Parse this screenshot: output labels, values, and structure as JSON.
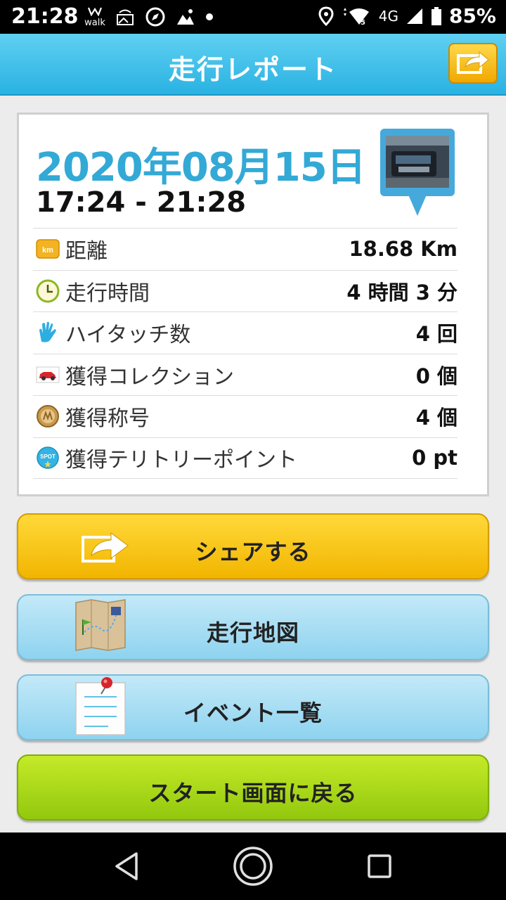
{
  "status_bar": {
    "time": "21:28",
    "walk_label": "walk",
    "network": "4G",
    "battery": "85%",
    "icons": [
      "walk-app-icon",
      "photo-frame-icon",
      "compass-icon",
      "gallery-icon",
      "dot-icon",
      "location-icon",
      "wifi-icon",
      "signal-icon",
      "battery-icon"
    ]
  },
  "header": {
    "title": "走行レポート",
    "share_icon": "share-arrow-icon"
  },
  "report": {
    "date": "2020年08月15日",
    "time_range": "17:24 - 21:28",
    "rows": [
      {
        "icon": "km-icon",
        "label": "距離",
        "value": "18.68 Km"
      },
      {
        "icon": "clock-icon",
        "label": "走行時間",
        "value": "4 時間 3 分"
      },
      {
        "icon": "hi-five-icon",
        "label": "ハイタッチ数",
        "value": "4 回"
      },
      {
        "icon": "car-icon",
        "label": "獲得コレクション",
        "value": "0 個"
      },
      {
        "icon": "medal-icon",
        "label": "獲得称号",
        "value": "4 個"
      },
      {
        "icon": "spot-icon",
        "label": "獲得テリトリーポイント",
        "value": "0 pt"
      }
    ],
    "km_text": "km",
    "spot_text": "SPOT"
  },
  "buttons": {
    "share": "シェアする",
    "map": "走行地図",
    "events": "イベント一覧",
    "back_to_start": "スタート画面に戻る"
  },
  "colors": {
    "accent_blue": "#33a9d6",
    "header_blue": "#2ab2e2",
    "share_yellow": "#f2b500",
    "start_green": "#92c80e"
  }
}
